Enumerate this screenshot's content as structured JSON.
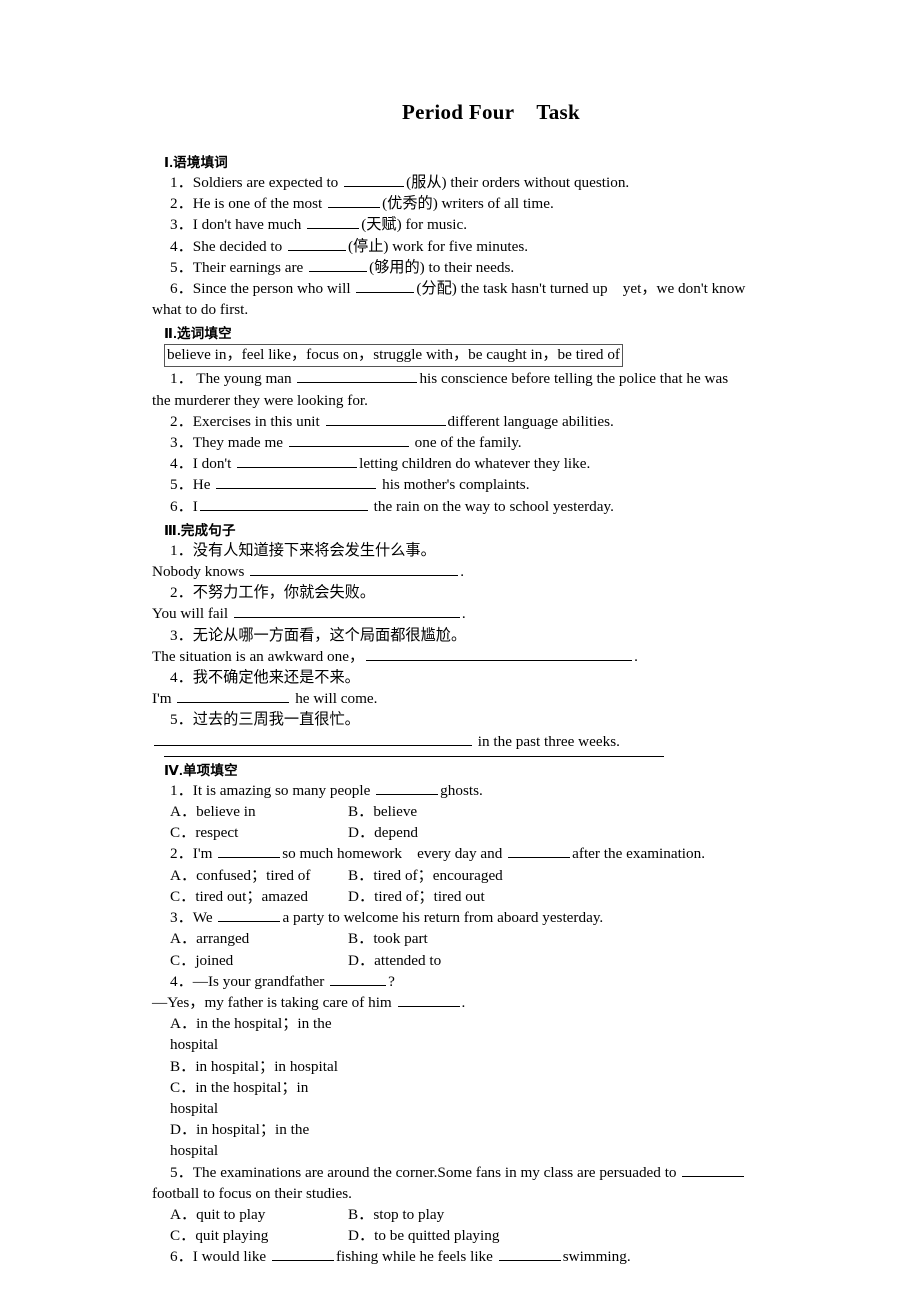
{
  "document": {
    "title_main": "Period Four",
    "title_sub": "Task"
  },
  "sections": [
    {
      "heading": "Ⅰ.语境填词",
      "items": [
        {
          "num": "1．",
          "pre": "Soldiers are expected to ",
          "blank": 60,
          "post": "(服从) their orders without question."
        },
        {
          "num": "2．",
          "pre": "He is one of the most ",
          "blank": 52,
          "post": "(优秀的) writers of all time."
        },
        {
          "num": "3．",
          "pre": "I don't have much ",
          "blank": 52,
          "post": "(天赋) for music."
        },
        {
          "num": "4．",
          "pre": "She decided to ",
          "blank": 58,
          "post": "(停止) work for five minutes."
        },
        {
          "num": "5．",
          "pre": "Their earnings are ",
          "blank": 58,
          "post": "(够用的) to their needs."
        },
        {
          "num": "6．",
          "pre": "Since the person who will ",
          "blank": 58,
          "post": "(分配) the task hasn't turned up　yet，we don't know"
        },
        {
          "num": "",
          "pre": "what to do first.",
          "blank": 0,
          "post": "",
          "flush": true
        }
      ]
    },
    {
      "heading": "Ⅱ.选词填空",
      "wordbank": "believe in，feel like，focus on，struggle with，be caught in，be tired of",
      "items": [
        {
          "num": "1．",
          "pre": " The young man ",
          "blank": 120,
          "post": "his conscience before telling the police that he was"
        },
        {
          "num": "",
          "pre": "the murderer they were looking for.",
          "blank": 0,
          "post": "",
          "flush": true
        },
        {
          "num": "2．",
          "pre": "Exercises in this unit ",
          "blank": 120,
          "post": "different language abilities."
        },
        {
          "num": "3．",
          "pre": "They made me ",
          "blank": 120,
          "post": " one of the family."
        },
        {
          "num": "4．",
          "pre": "I don't ",
          "blank": 120,
          "post": "letting children do whatever they like."
        },
        {
          "num": "5．",
          "pre": "He ",
          "blank": 160,
          "post": " his mother's complaints."
        },
        {
          "num": "6．",
          "pre": "I",
          "blank": 168,
          "post": " the rain on the way to school yesterday."
        }
      ]
    },
    {
      "heading": "Ⅲ.完成句子",
      "items": [
        {
          "num": "1．",
          "pre": "没有人知道接下来将会发生什么事。",
          "blank": 0,
          "post": "",
          "cn": true
        },
        {
          "num": "",
          "pre": "Nobody knows ",
          "blank": 208,
          "post": ".",
          "flush": true
        },
        {
          "num": "2．",
          "pre": "不努力工作，你就会失败。",
          "blank": 0,
          "post": "",
          "cn": true
        },
        {
          "num": "",
          "pre": "You will fail ",
          "blank": 226,
          "post": ".",
          "flush": true
        },
        {
          "num": "3．",
          "pre": "无论从哪一方面看，这个局面都很尴尬。",
          "blank": 0,
          "post": "",
          "cn": true
        },
        {
          "num": "",
          "pre": "The situation is an awkward one，",
          "blank": 266,
          "post": ".",
          "flush": true
        },
        {
          "num": "4．",
          "pre": "我不确定他来还是不来。",
          "blank": 0,
          "post": "",
          "cn": true
        },
        {
          "num": "",
          "pre": "I'm ",
          "blank": 112,
          "post": " he will come.",
          "flush": true
        },
        {
          "num": "5．",
          "pre": "过去的三周我一直很忙。",
          "blank": 0,
          "post": "",
          "cn": true
        },
        {
          "num": "",
          "pre": "",
          "blank": 318,
          "post": " in the past three weeks.",
          "flush": true
        }
      ]
    },
    {
      "heading": "Ⅳ.单项填空",
      "rule_top": true,
      "items": [
        {
          "num": "1．",
          "pre": "It is amazing so many people ",
          "blank": 62,
          "post": "ghosts."
        },
        {
          "opts": [
            "A．believe in",
            "B．believe"
          ]
        },
        {
          "opts": [
            "C．respect",
            "D．depend"
          ]
        },
        {
          "num": "2．",
          "pre": "I'm ",
          "blank": 62,
          "post": "so much homework　every day and ",
          "blank2": 62,
          "post2": "after the examination."
        },
        {
          "opts": [
            "A．confused；tired of",
            "B．tired of；encouraged"
          ]
        },
        {
          "opts": [
            "C．tired out；amazed",
            "D．tired of；tired out"
          ]
        },
        {
          "num": "3．",
          "pre": "We ",
          "blank": 62,
          "post": "a party to welcome his return from aboard yesterday."
        },
        {
          "opts": [
            "A．arranged",
            "B．took part"
          ]
        },
        {
          "opts": [
            "C．joined",
            "D．attended to"
          ]
        },
        {
          "num": "4．",
          "pre": "—Is your grandfather ",
          "blank": 56,
          "post": "?"
        },
        {
          "num": "",
          "pre": "—Yes，my father is taking care of him ",
          "blank": 62,
          "post": ".",
          "flush": true
        },
        {
          "opts": [
            "A．in the hospital；in the hospital"
          ]
        },
        {
          "opts": [
            "B．in hospital；in hospital"
          ]
        },
        {
          "opts": [
            "C．in the hospital；in hospital"
          ]
        },
        {
          "opts": [
            "D．in hospital；in the hospital"
          ]
        },
        {
          "num": "5．",
          "pre": "The examinations are around the corner.Some fans in my class are persuaded to ",
          "blank": 62,
          "post": ""
        },
        {
          "num": "",
          "pre": "football to focus on their studies.",
          "blank": 0,
          "post": "",
          "flush": true
        },
        {
          "opts": [
            "A．quit to play",
            "B．stop to play"
          ]
        },
        {
          "opts": [
            "C．quit playing",
            "D．to be quitted playing"
          ]
        },
        {
          "num": "6．",
          "pre": "I would like ",
          "blank": 62,
          "post": "fishing while he feels like ",
          "blank2": 62,
          "post2": "swimming."
        }
      ]
    }
  ]
}
